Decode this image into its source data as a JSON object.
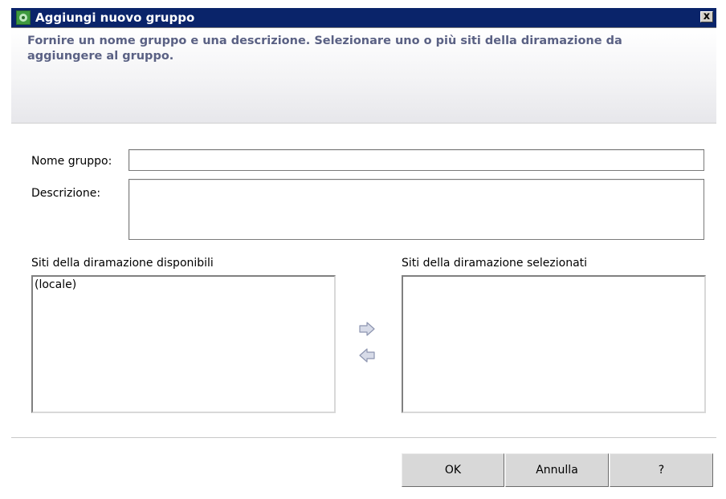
{
  "window": {
    "title": "Aggiungi nuovo gruppo",
    "close_label": "x",
    "icon": "app-icon"
  },
  "header": {
    "instruction": "Fornire un nome gruppo e una descrizione. Selezionare uno o più siti della diramazione da aggiungere al gruppo."
  },
  "form": {
    "name_label": "Nome gruppo:",
    "name_value": "",
    "description_label": "Descrizione:",
    "description_value": ""
  },
  "available": {
    "label": "Siti della diramazione disponibili",
    "items": [
      "(locale)"
    ]
  },
  "selected": {
    "label": "Siti della diramazione selezionati",
    "items": []
  },
  "arrows": {
    "add_icon": "arrow-right-icon",
    "remove_icon": "arrow-left-icon"
  },
  "buttons": {
    "ok": "OK",
    "cancel": "Annulla",
    "help": "?"
  },
  "colors": {
    "titlebar": "#0a246a",
    "instruction_text": "#5a6184",
    "arrow_fill": "#d7dbe8",
    "arrow_stroke": "#8d95b0"
  }
}
